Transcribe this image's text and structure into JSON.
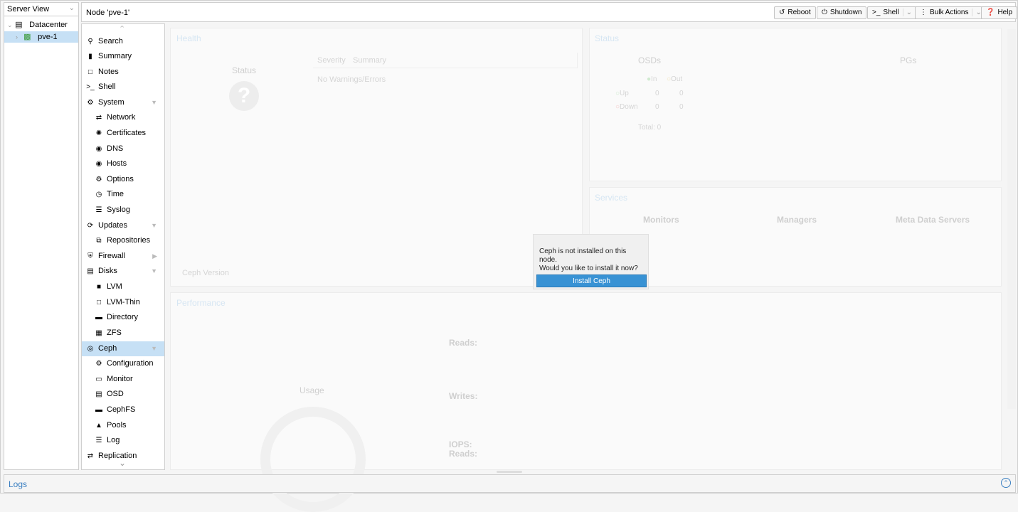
{
  "tree": {
    "view_select": "Server View",
    "datacenter": "Datacenter",
    "node": "pve-1"
  },
  "header": {
    "title": "Node 'pve-1'",
    "reboot": "Reboot",
    "shutdown": "Shutdown",
    "shell": "Shell",
    "bulk_actions": "Bulk Actions",
    "help": "Help"
  },
  "nav": {
    "search": "Search",
    "summary": "Summary",
    "notes": "Notes",
    "shell": "Shell",
    "system": "System",
    "network": "Network",
    "certificates": "Certificates",
    "dns": "DNS",
    "hosts": "Hosts",
    "options": "Options",
    "time": "Time",
    "syslog": "Syslog",
    "updates": "Updates",
    "repositories": "Repositories",
    "firewall": "Firewall",
    "disks": "Disks",
    "lvm": "LVM",
    "lvm_thin": "LVM-Thin",
    "directory": "Directory",
    "zfs": "ZFS",
    "ceph": "Ceph",
    "configuration": "Configuration",
    "monitor": "Monitor",
    "osd": "OSD",
    "cephfs": "CephFS",
    "pools": "Pools",
    "log": "Log",
    "replication": "Replication"
  },
  "health": {
    "title": "Health",
    "status_label": "Status",
    "col_severity": "Severity",
    "col_summary": "Summary",
    "empty": "No Warnings/Errors",
    "ceph_version": "Ceph Version"
  },
  "status": {
    "title": "Status",
    "osds": "OSDs",
    "pgs": "PGs",
    "in": "In",
    "out": "Out",
    "up": "Up",
    "down": "Down",
    "up_in": "0",
    "up_out": "0",
    "down_in": "0",
    "down_out": "0",
    "total": "Total: 0"
  },
  "services": {
    "title": "Services",
    "monitors": "Monitors",
    "managers": "Managers",
    "mds": "Meta Data Servers"
  },
  "performance": {
    "title": "Performance",
    "usage": "Usage",
    "reads": "Reads:",
    "writes": "Writes:",
    "iops": "IOPS:",
    "iops_reads": "Reads:"
  },
  "modal": {
    "line1": "Ceph is not installed on this node.",
    "line2": "Would you like to install it now?",
    "button": "Install Ceph"
  },
  "logs": {
    "title": "Logs"
  },
  "colors": {
    "accent": "#3892d4",
    "selected": "#c6e0f5"
  }
}
